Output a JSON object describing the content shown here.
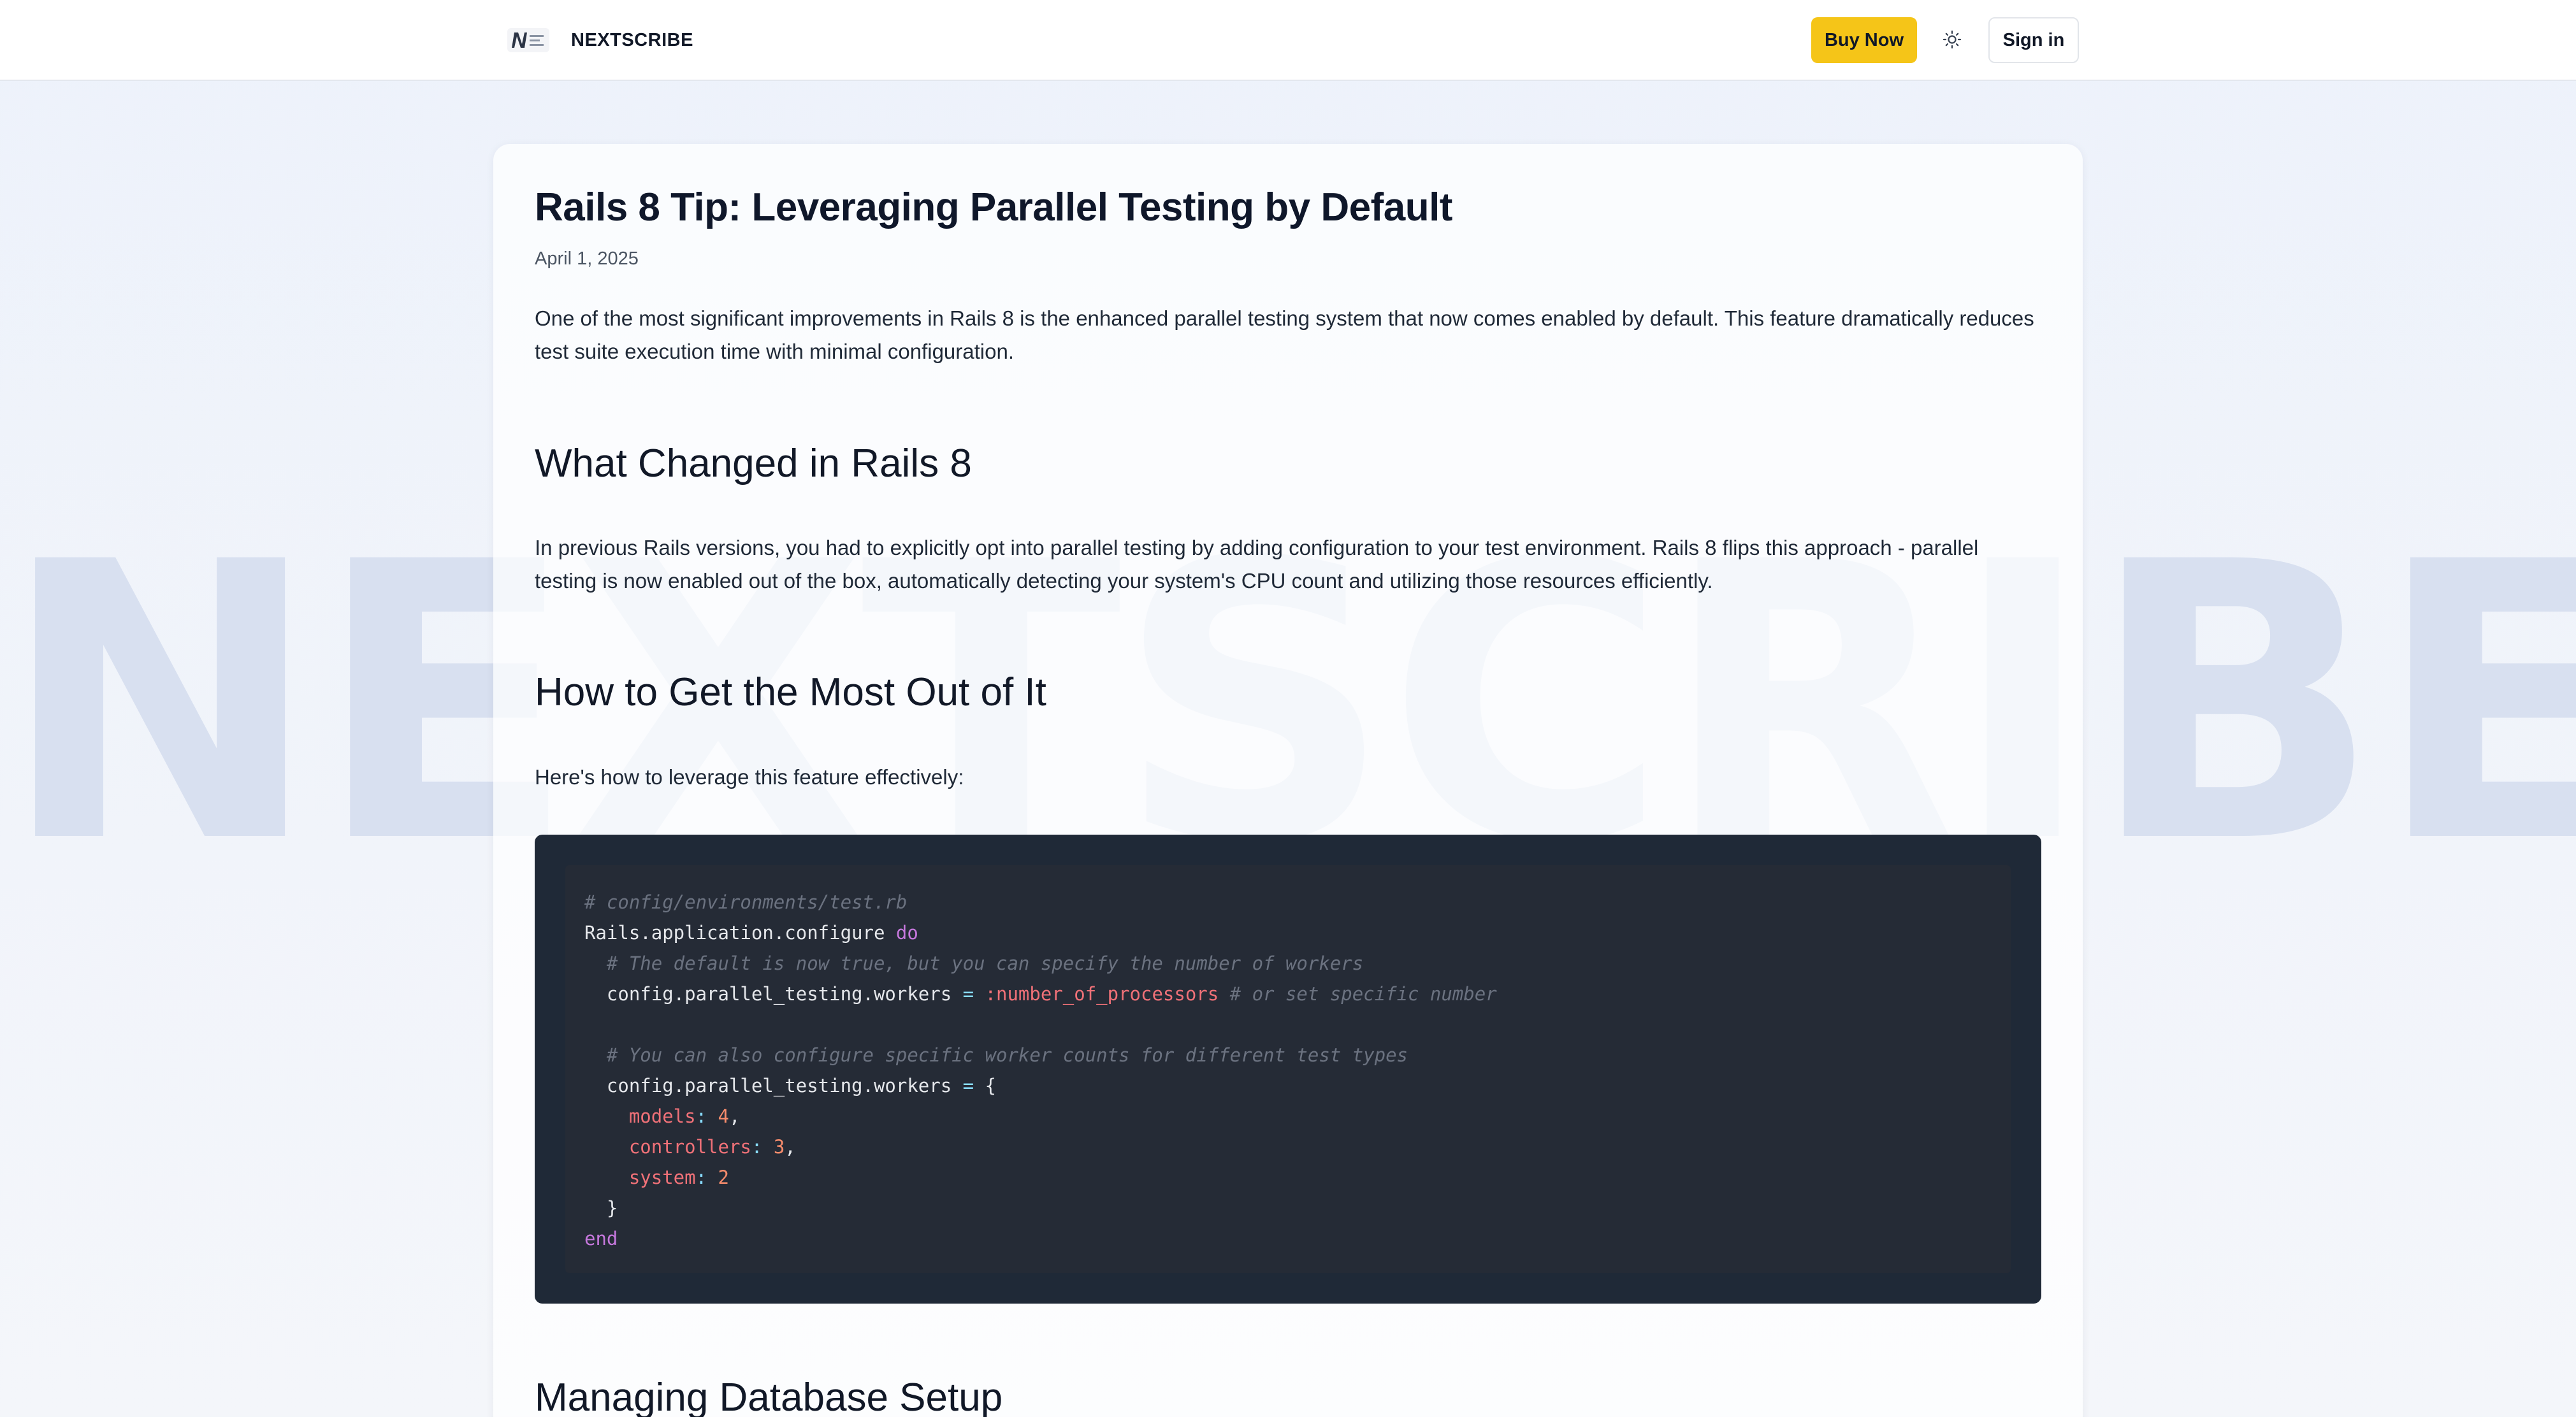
{
  "header": {
    "brand": "NEXTSCRIBE",
    "buy_label": "Buy Now",
    "signin_label": "Sign in"
  },
  "watermark": "NEXTSCRIBE",
  "article": {
    "title": "Rails 8 Tip: Leveraging Parallel Testing by Default",
    "date": "April 1, 2025",
    "intro": "One of the most significant improvements in Rails 8 is the enhanced parallel testing system that now comes enabled by default. This feature dramatically reduces test suite execution time with minimal configuration.",
    "h_changed": "What Changed in Rails 8",
    "p_changed": "In previous Rails versions, you had to explicitly opt into parallel testing by adding configuration to your test environment. Rails 8 flips this approach - parallel testing is now enabled out of the box, automatically detecting your system's CPU count and utilizing those resources efficiently.",
    "h_howto": "How to Get the Most Out of It",
    "p_howto": "Here's how to leverage this feature effectively:",
    "h_db": "Managing Database Setup"
  },
  "code": {
    "l1": "# config/environments/test.rb",
    "l2a": "Rails.application.configure ",
    "l2b": "do",
    "l3": "  # The default is now true, but you can specify the number of workers",
    "l4a": "  config.parallel_testing.workers ",
    "l4b": "=",
    "l4c": " :number_of_processors",
    "l4d": " # or set specific number",
    "l6": "  # You can also configure specific worker counts for different test types",
    "l7a": "  config.parallel_testing.workers ",
    "l7b": "=",
    "l7c": " {",
    "l8a": "    models",
    "l8b": ": ",
    "l8c": "4",
    "l8d": ",",
    "l9a": "    controllers",
    "l9b": ": ",
    "l9c": "3",
    "l9d": ",",
    "l10a": "    system",
    "l10b": ": ",
    "l10c": "2",
    "l11": "  }",
    "l12": "end"
  },
  "colors": {
    "accent": "#f5c518",
    "code_bg": "#1f2937"
  },
  "icons": {
    "logo": "nextscribe-logo-icon",
    "theme": "sun-icon"
  }
}
